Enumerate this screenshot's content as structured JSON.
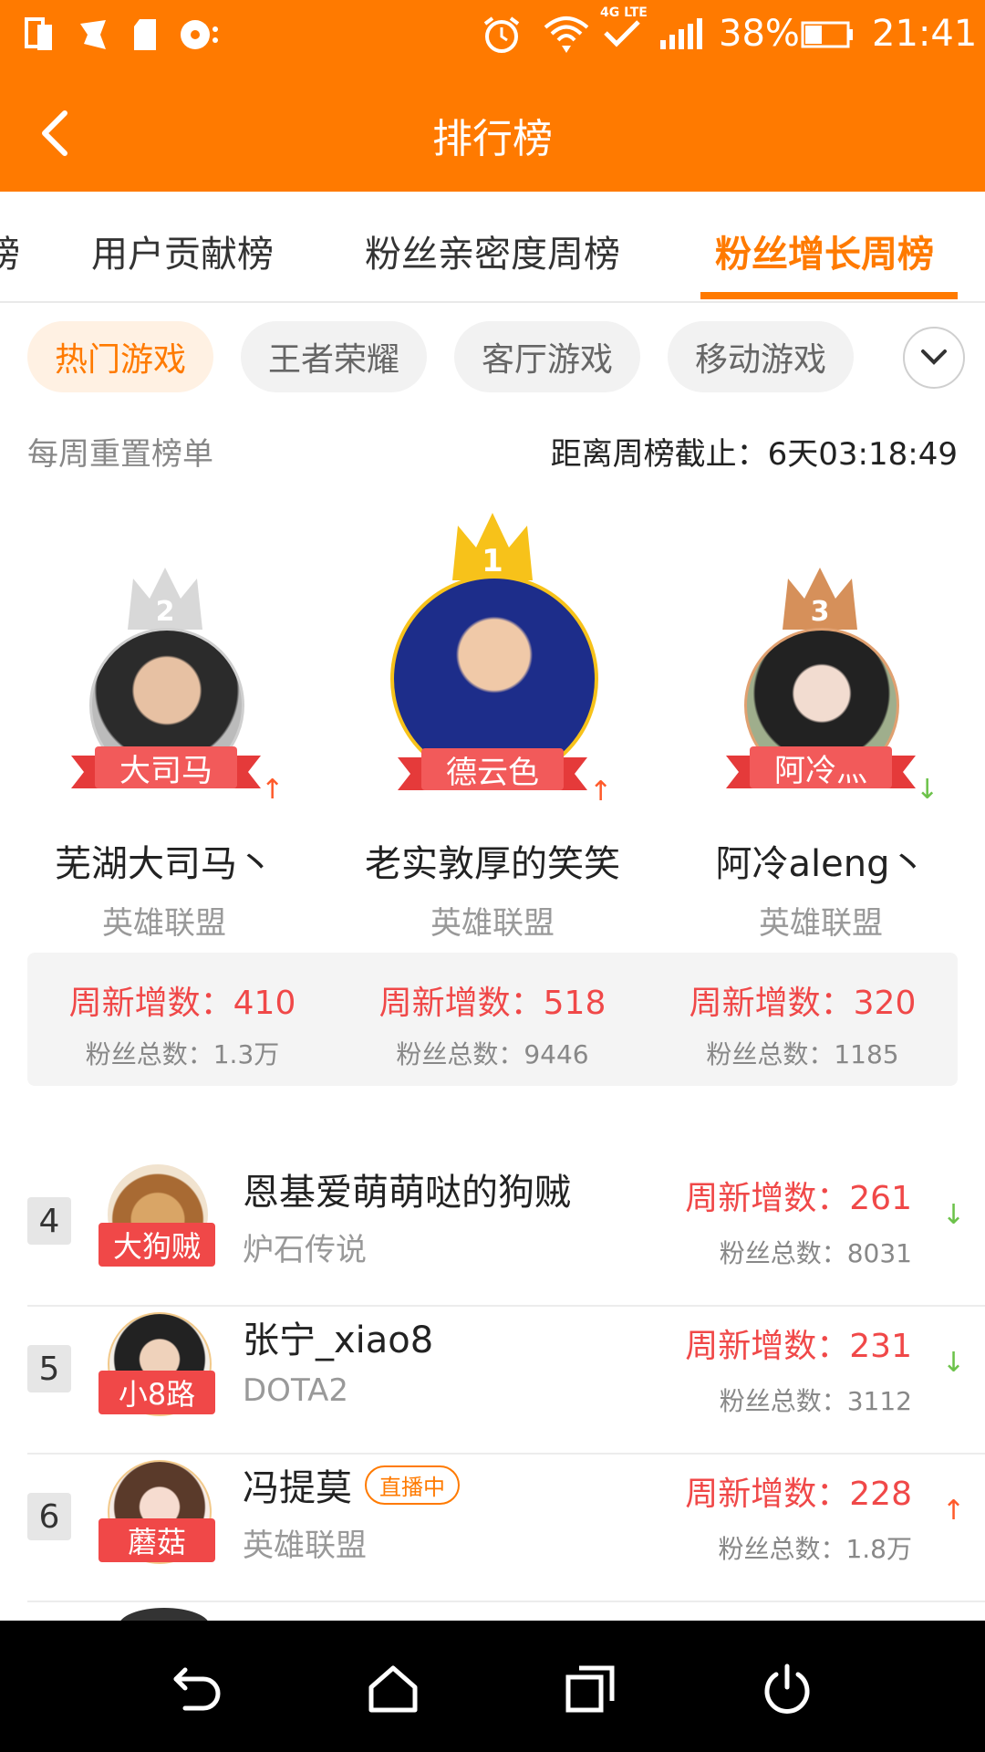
{
  "status_bar": {
    "battery": "38%",
    "time": "21:41",
    "network": "4G LTE",
    "icons": [
      "copy-icon",
      "mascot-icon",
      "sdcard-icon",
      "disc-icon",
      "alarm-icon",
      "wifi-icon",
      "signal-icon",
      "battery-icon"
    ]
  },
  "header": {
    "title": "排行榜",
    "back_icon": "chevron-left-icon"
  },
  "tabs": [
    {
      "label": "榜"
    },
    {
      "label": "用户贡献榜"
    },
    {
      "label": "粉丝亲密度周榜"
    },
    {
      "label": "粉丝增长周榜",
      "active": true
    }
  ],
  "chips": [
    {
      "label": "热门游戏",
      "active": true
    },
    {
      "label": "王者荣耀"
    },
    {
      "label": "客厅游戏"
    },
    {
      "label": "移动游戏"
    }
  ],
  "chips_more_icon": "chevron-down-icon",
  "info": {
    "left": "每周重置榜单",
    "right_label": "距离周榜截止：",
    "countdown": "6天03:18:49"
  },
  "podium": [
    {
      "rank": "2",
      "tag": "大司马",
      "name": "芜湖大司马丶",
      "game": "英雄联盟",
      "new_label": "周新增数：410",
      "total_label": "粉丝总数：1.3万",
      "trend": "up",
      "crown_color": "#d8d8d8",
      "border_color": "#cfcfcf"
    },
    {
      "rank": "1",
      "tag": "德云色",
      "name": "老实敦厚的笑笑",
      "game": "英雄联盟",
      "new_label": "周新增数：518",
      "total_label": "粉丝总数：9446",
      "trend": "up",
      "crown_color": "#f7c21a",
      "border_color": "#f7c21a"
    },
    {
      "rank": "3",
      "tag": "阿冷灬",
      "name": "阿冷aleng丶",
      "game": "英雄联盟",
      "new_label": "周新增数：320",
      "total_label": "粉丝总数：1185",
      "trend": "down",
      "crown_color": "#d6905a",
      "border_color": "#e0a070"
    }
  ],
  "list": [
    {
      "rank": "4",
      "tag": "大狗贼",
      "name": "恩基爱萌萌哒的狗贼",
      "game": "炉石传说",
      "new_label": "周新增数：261",
      "total_label": "粉丝总数：8031",
      "trend": "down",
      "live": false
    },
    {
      "rank": "5",
      "tag": "小8路",
      "name": "张宁_xiao8",
      "game": "DOTA2",
      "new_label": "周新增数：231",
      "total_label": "粉丝总数：3112",
      "trend": "down",
      "live": false
    },
    {
      "rank": "6",
      "tag": "蘑菇",
      "name": "冯提莫",
      "game": "英雄联盟",
      "new_label": "周新增数：228",
      "total_label": "粉丝总数：1.8万",
      "trend": "up",
      "live": true,
      "live_label": "直播中"
    }
  ],
  "colors": {
    "accent": "#ff7a00",
    "red": "#f04848",
    "up": "#ff5a2a",
    "down": "#6cc24a"
  },
  "navbar": {
    "icons": [
      "back-icon",
      "home-icon",
      "recents-icon",
      "power-icon"
    ]
  }
}
